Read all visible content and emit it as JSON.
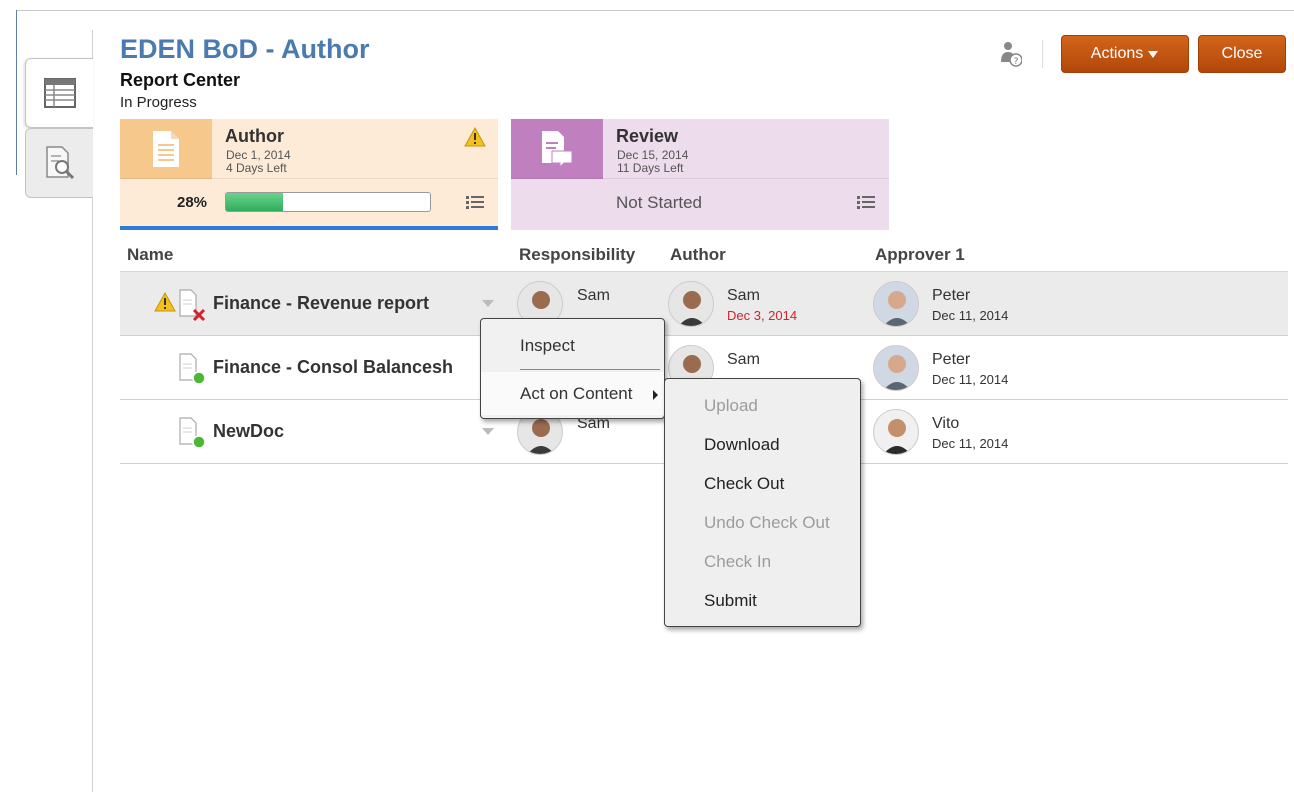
{
  "header": {
    "title": "EDEN BoD - Author",
    "subtitle": "Report Center",
    "status": "In Progress",
    "actions_label": "Actions",
    "close_label": "Close"
  },
  "stages": [
    {
      "name": "Author",
      "date": "Dec 1, 2014",
      "days_left": "4 Days Left",
      "percent_label": "28%",
      "progress": 0.28,
      "color": "#f6c88c"
    },
    {
      "name": "Review",
      "date": "Dec 15, 2014",
      "days_left": "11 Days Left",
      "status": "Not Started",
      "color": "#c07fbe"
    }
  ],
  "columns": {
    "name": "Name",
    "responsibility": "Responsibility",
    "author": "Author",
    "approver1": "Approver 1"
  },
  "rows": [
    {
      "name": "Finance - Revenue report",
      "responsibility": "Sam",
      "author": "Sam",
      "author_date": "Dec 3, 2014",
      "approver": "Peter",
      "approver_date": "Dec 11, 2014"
    },
    {
      "name": "Finance - Consol Balancesh",
      "author": "Sam",
      "approver": "Peter",
      "approver_date": "Dec 11, 2014"
    },
    {
      "name": "NewDoc",
      "responsibility": "Sam",
      "approver": "Vito",
      "approver_date": "Dec 11, 2014"
    }
  ],
  "context_menu": {
    "inspect": "Inspect",
    "act_on_content": "Act on Content"
  },
  "submenu": [
    {
      "label": "Upload",
      "enabled": false
    },
    {
      "label": "Download",
      "enabled": true
    },
    {
      "label": "Check Out",
      "enabled": true
    },
    {
      "label": "Undo Check Out",
      "enabled": false
    },
    {
      "label": "Check In",
      "enabled": false
    },
    {
      "label": "Submit",
      "enabled": true
    }
  ],
  "icons": {
    "tabs": [
      "table-view-icon",
      "inspect-document-icon"
    ],
    "header": "user-help-icon",
    "warning": "warning-icon",
    "doc_error": "document-error-icon",
    "doc_ok": "document-ok-icon"
  }
}
